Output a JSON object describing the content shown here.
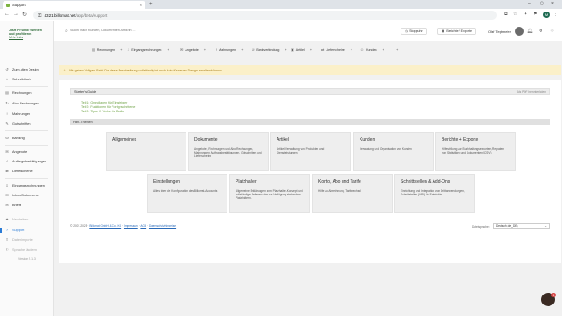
{
  "browser": {
    "tab_title": "Support",
    "tab_close": "×",
    "new_tab": "+",
    "url_host": "4321.billomat.net",
    "url_path": "/app/beta/support",
    "profile_initial": "M",
    "nav": {
      "back": "←",
      "forward": "→",
      "reload": "↻"
    },
    "window": {
      "minimize": "–",
      "maximize": "▢",
      "close": "×"
    },
    "ext_icons": [
      "⧉",
      "☆",
      "✦",
      "⚑",
      "⋮"
    ]
  },
  "sidebar": {
    "promo_title": "Jetzt Freunde werben und profitieren",
    "promo_link": "Mehr Infos",
    "items": [
      {
        "label": "Zum alten Design",
        "icon": "↺"
      },
      {
        "label": "Schreibtisch",
        "icon": "⌂"
      },
      {
        "label": "Rechnungen",
        "icon": "▤"
      },
      {
        "label": "Abo-Rechnungen",
        "icon": "↻"
      },
      {
        "label": "Mahnungen",
        "icon": "!"
      },
      {
        "label": "Gutschriften",
        "icon": "✎"
      },
      {
        "label": "Banking",
        "icon": "⛁"
      },
      {
        "label": "Angebote",
        "icon": "✉"
      },
      {
        "label": "Auftragsbestätigungen",
        "icon": "✓"
      },
      {
        "label": "Lieferscheine",
        "icon": "⇄"
      },
      {
        "label": "Eingangsrechnungen",
        "icon": "⇩"
      },
      {
        "label": "Inbox Dokumente",
        "icon": "✉"
      },
      {
        "label": "Briefe",
        "icon": "✉"
      },
      {
        "label": "Neuheiten",
        "icon": "★"
      },
      {
        "label": "Support",
        "icon": "?"
      },
      {
        "label": "Datenimporte",
        "icon": "⇪"
      },
      {
        "label": "Sprache ändern",
        "icon": "⚐"
      }
    ],
    "version": "Version 2.1.3"
  },
  "appbar": {
    "search_placeholder": "Suche nach Kunden, Dokumenten, Artikeln ...",
    "btn_stoppuhr": "Stoppuhr",
    "btn_berichte": "Berichte / Exporte",
    "user_name": "Olaf Tegtmeier"
  },
  "menubar": [
    "Rechnungen",
    "Eingangsrechnungen",
    "Angebote",
    "Mahnungen",
    "Bankverbindung",
    "Artikel",
    "Lieferscheine",
    "Kunden"
  ],
  "notice": "Wir geben Vollgas! Bald! Da diese Beschreibung vollständig ist noch kein für neuen Design erhalten können.",
  "starter": {
    "title": "Starter's Guide",
    "right": "Als PDF herunterladen",
    "links": [
      "Teil 1: Grundlagen für Einsteiger",
      "Teil 2: Funktionen für Fortgeschrittene",
      "Teil 3: Tipps & Tricks für Profis"
    ]
  },
  "help_title": "Hilfe-Themen",
  "cards": [
    {
      "title": "Allgemeines",
      "desc": ""
    },
    {
      "title": "Dokumente",
      "desc": "Angebote, Rechnungen und Abo-Rechnungen, Mahnungen, Auftragsbestätigungen, Gutschriften und Lieferscheine"
    },
    {
      "title": "Artikel",
      "desc": "Artikel-Verwaltung von Produkten und Dienstleistungen"
    },
    {
      "title": "Kunden",
      "desc": "Verwaltung und Organisation von Kunden"
    },
    {
      "title": "Berichte + Exporte",
      "desc": "Hilfestellung zur Buchhaltungsexporten, Reporten von Statistiken und Dokumenten (CSV)"
    },
    {
      "title": "Einstellungen",
      "desc": "Alles über die Konfiguration des Billomat-Accounts"
    },
    {
      "title": "Platzhalter",
      "desc": "Allgemeine Erklärungen zum Platzhalter-Konzept und vollständige Referenz der zur Verfügung stehenden Platzhaltern."
    },
    {
      "title": "Konto, Abo und Tarife",
      "desc": "Hilfe zu Abrechnung, Tarifwechsel"
    },
    {
      "title": "Schnittstellen & Add-Ons",
      "desc": "Einrichtung und Integration von Drittanwendungen, Schnittstellen (API) für Entwickler"
    }
  ],
  "footer": {
    "copyright": "© 2007-2025",
    "links": [
      "Billomat GmbH & Co. KG",
      "Impressum",
      "AGB",
      "Datenschutzhinweise"
    ],
    "lang_label": "Dateisprache:",
    "lang_value": "Deutsch (de_DE)"
  },
  "chat_badge": "1"
}
